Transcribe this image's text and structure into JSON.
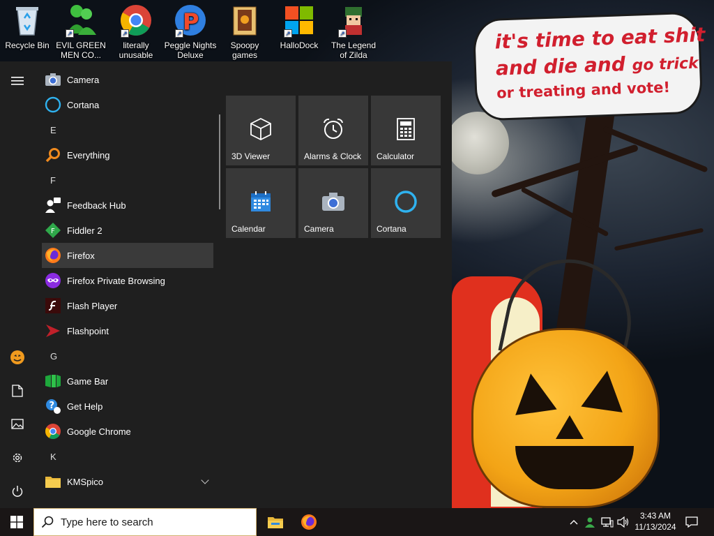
{
  "desktop": {
    "icons": [
      {
        "label": "Recycle Bin",
        "icon": "recycle-bin-icon"
      },
      {
        "label": "EVIL GREEN MEN CO...",
        "icon": "green-men-icon"
      },
      {
        "label": "literally unusable",
        "icon": "chrome-icon"
      },
      {
        "label": "Peggle Nights Deluxe",
        "icon": "peggle-icon"
      },
      {
        "label": "Spoopy games",
        "icon": "folder-icon"
      },
      {
        "label": "HalloDock",
        "icon": "windows-logo-icon"
      },
      {
        "label": "The Legend of Zilda",
        "icon": "zilda-icon"
      }
    ]
  },
  "wallpaper": {
    "bubble_line1": "it's time to eat shit",
    "bubble_line2a": "and die and",
    "bubble_line2b": "go trick",
    "bubble_line3": "or treating and vote!"
  },
  "start_menu": {
    "apps": [
      {
        "label": "Camera",
        "icon": "camera-icon"
      },
      {
        "label": "Cortana",
        "icon": "cortana-icon"
      },
      {
        "letter": "E"
      },
      {
        "label": "Everything",
        "icon": "search-magnifier-icon"
      },
      {
        "letter": "F"
      },
      {
        "label": "Feedback Hub",
        "icon": "feedback-hub-icon"
      },
      {
        "label": "Fiddler 2",
        "icon": "fiddler-icon"
      },
      {
        "label": "Firefox",
        "icon": "firefox-icon"
      },
      {
        "label": "Firefox Private Browsing",
        "icon": "firefox-private-icon"
      },
      {
        "label": "Flash Player",
        "icon": "flash-player-icon"
      },
      {
        "label": "Flashpoint",
        "icon": "flashpoint-icon"
      },
      {
        "letter": "G"
      },
      {
        "label": "Game Bar",
        "icon": "game-bar-icon"
      },
      {
        "label": "Get Help",
        "icon": "get-help-icon"
      },
      {
        "label": "Google Chrome",
        "icon": "chrome-icon"
      },
      {
        "letter": "K"
      },
      {
        "label": "KMSpico",
        "icon": "folder-icon"
      }
    ],
    "tiles": [
      {
        "label": "3D Viewer",
        "icon": "cube-icon"
      },
      {
        "label": "Alarms & Clock",
        "icon": "alarm-clock-icon"
      },
      {
        "label": "Calculator",
        "icon": "calculator-icon"
      },
      {
        "label": "Calendar",
        "icon": "calendar-icon"
      },
      {
        "label": "Camera",
        "icon": "camera-icon"
      },
      {
        "label": "Cortana",
        "icon": "cortana-icon"
      }
    ]
  },
  "taskbar": {
    "search_placeholder": "Type here to search",
    "time": "3:43 AM",
    "date": "11/13/2024"
  }
}
